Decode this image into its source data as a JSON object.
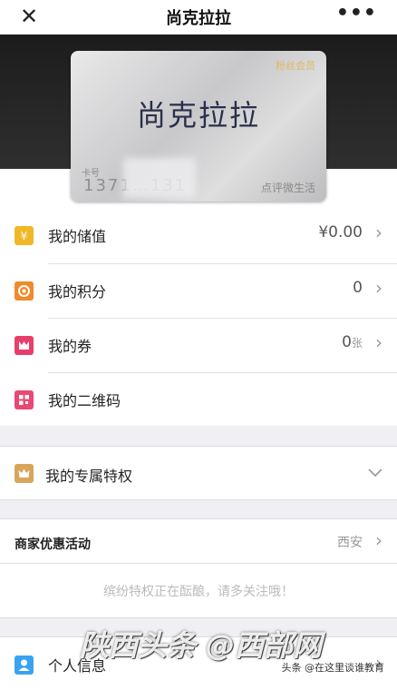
{
  "header": {
    "close_icon": "close-icon",
    "title": "尚克拉拉",
    "more_icon": "more-icon",
    "more_glyph": "•••",
    "close_glyph": "✕"
  },
  "card": {
    "tag": "粉丝会员",
    "name": "尚克拉拉",
    "number_label": "卡号",
    "number": "1371…131",
    "brand": "点评微生活"
  },
  "menu": [
    {
      "label": "我的储值",
      "value": "¥0.00",
      "icon": "wallet-icon"
    },
    {
      "label": "我的积分",
      "value": "0",
      "icon": "points-icon"
    },
    {
      "label": "我的券",
      "value": "0",
      "unit": "张",
      "icon": "coupon-icon"
    },
    {
      "label": "我的二维码",
      "icon": "qr-code-icon"
    }
  ],
  "privilege": {
    "label": "我的专属特权",
    "icon": "crown-icon"
  },
  "merchant": {
    "title": "商家优惠活动",
    "city": "西安",
    "notice": "缤纷特权正在酝酿，请多关注哦！"
  },
  "personal": {
    "label": "个人信息",
    "icon": "user-icon"
  },
  "overlay": {
    "watermark": "陕西头条 @西部网",
    "source": "头条 @在这里谈谁教育"
  },
  "colors": {
    "stored": "#f0b728",
    "points": "#f08a2a",
    "coupon": "#e83e6b",
    "qr": "#e84873",
    "crown": "#d7a65a",
    "user": "#3aa3ef"
  }
}
